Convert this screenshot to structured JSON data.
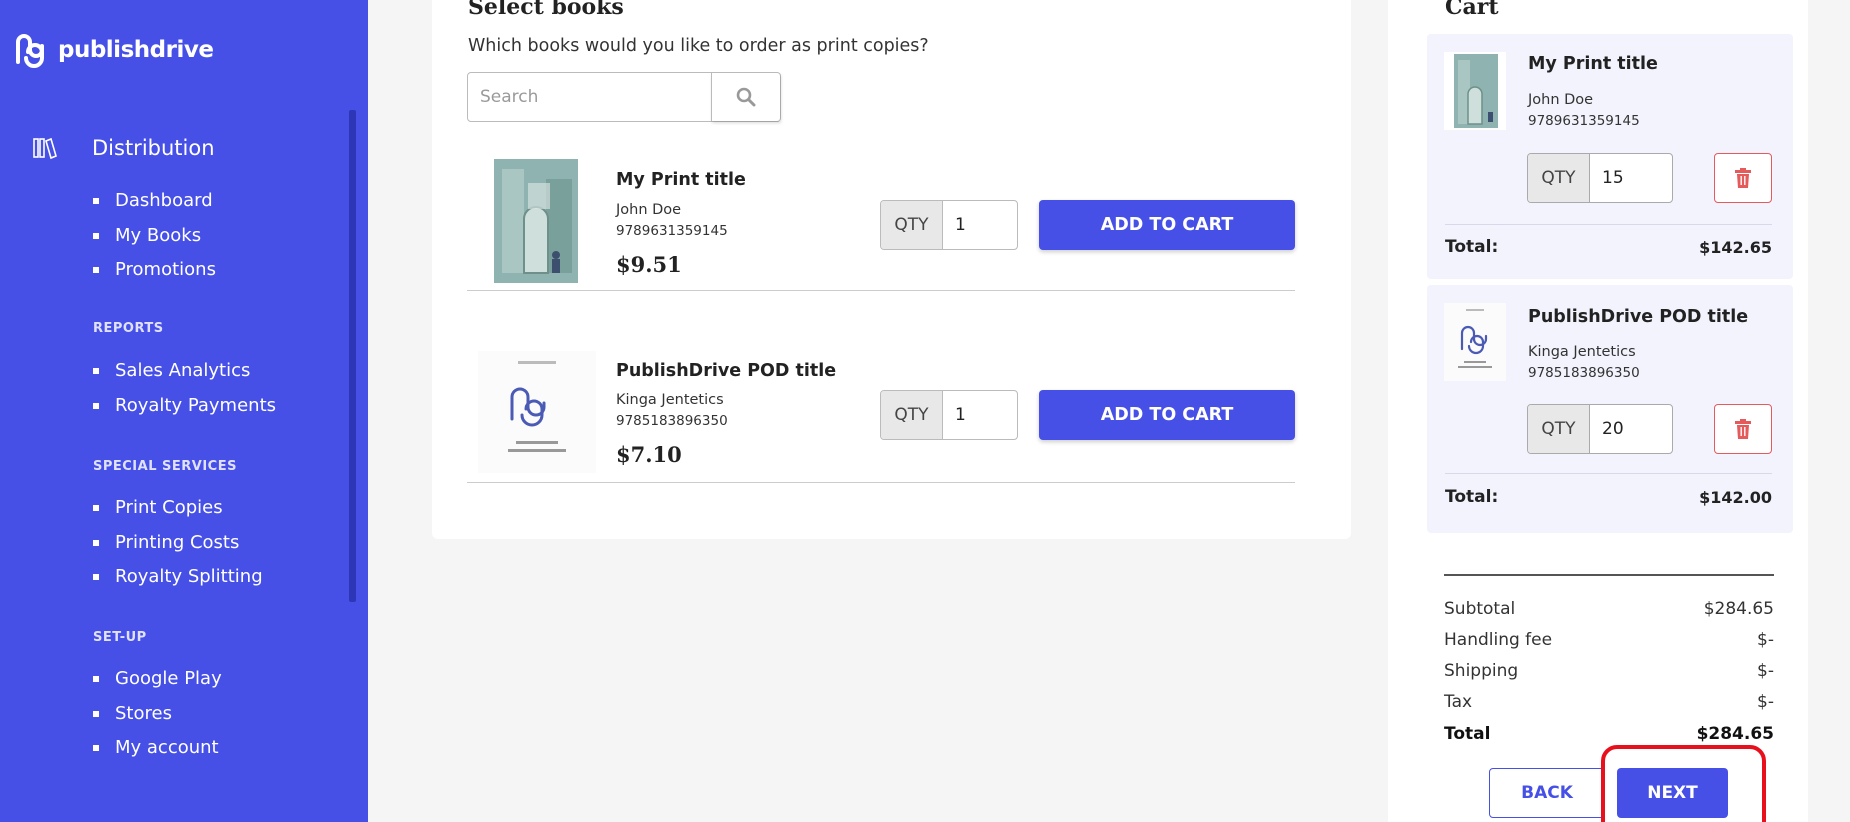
{
  "brand": {
    "name": "publishdrive"
  },
  "sidebar": {
    "main_section": "Distribution",
    "distribution_items": [
      {
        "label": "Dashboard"
      },
      {
        "label": "My Books"
      },
      {
        "label": "Promotions"
      }
    ],
    "reports_heading": "REPORTS",
    "reports_items": [
      {
        "label": "Sales Analytics"
      },
      {
        "label": "Royalty Payments"
      }
    ],
    "special_heading": "SPECIAL SERVICES",
    "special_items": [
      {
        "label": "Print Copies"
      },
      {
        "label": "Printing Costs"
      },
      {
        "label": "Royalty Splitting"
      }
    ],
    "setup_heading": "SET-UP",
    "setup_items": [
      {
        "label": "Google Play"
      },
      {
        "label": "Stores"
      },
      {
        "label": "My account"
      }
    ]
  },
  "select_books": {
    "title": "Select books",
    "subtitle": "Which books would you like to order as print copies?",
    "search_placeholder": "Search",
    "books": [
      {
        "title": "My Print title",
        "author": "John Doe",
        "isbn": "9789631359145",
        "price": "$9.51",
        "qty_label": "QTY",
        "qty": "1",
        "add_label": "ADD TO CART"
      },
      {
        "title": "PublishDrive POD title",
        "author": "Kinga Jentetics",
        "isbn": "9785183896350",
        "price": "$7.10",
        "qty_label": "QTY",
        "qty": "1",
        "add_label": "ADD TO CART"
      }
    ]
  },
  "cart": {
    "title": "Cart",
    "items": [
      {
        "title": "My Print title",
        "author": "John Doe",
        "isbn": "9789631359145",
        "qty_label": "QTY",
        "qty": "15",
        "total_label": "Total:",
        "total": "$142.65"
      },
      {
        "title": "PublishDrive POD title",
        "author": "Kinga Jentetics",
        "isbn": "9785183896350",
        "qty_label": "QTY",
        "qty": "20",
        "total_label": "Total:",
        "total": "$142.00"
      }
    ],
    "summary": [
      {
        "label": "Subtotal",
        "value": "$284.65"
      },
      {
        "label": "Handling fee",
        "value": "$-"
      },
      {
        "label": "Shipping",
        "value": "$-"
      },
      {
        "label": "Tax",
        "value": "$-"
      },
      {
        "label": "Total",
        "value": "$284.65"
      }
    ],
    "back_label": "BACK",
    "next_label": "NEXT"
  },
  "colors": {
    "brand": "#4650e6",
    "danger": "#e55a5a",
    "highlight": "#e8101c"
  }
}
